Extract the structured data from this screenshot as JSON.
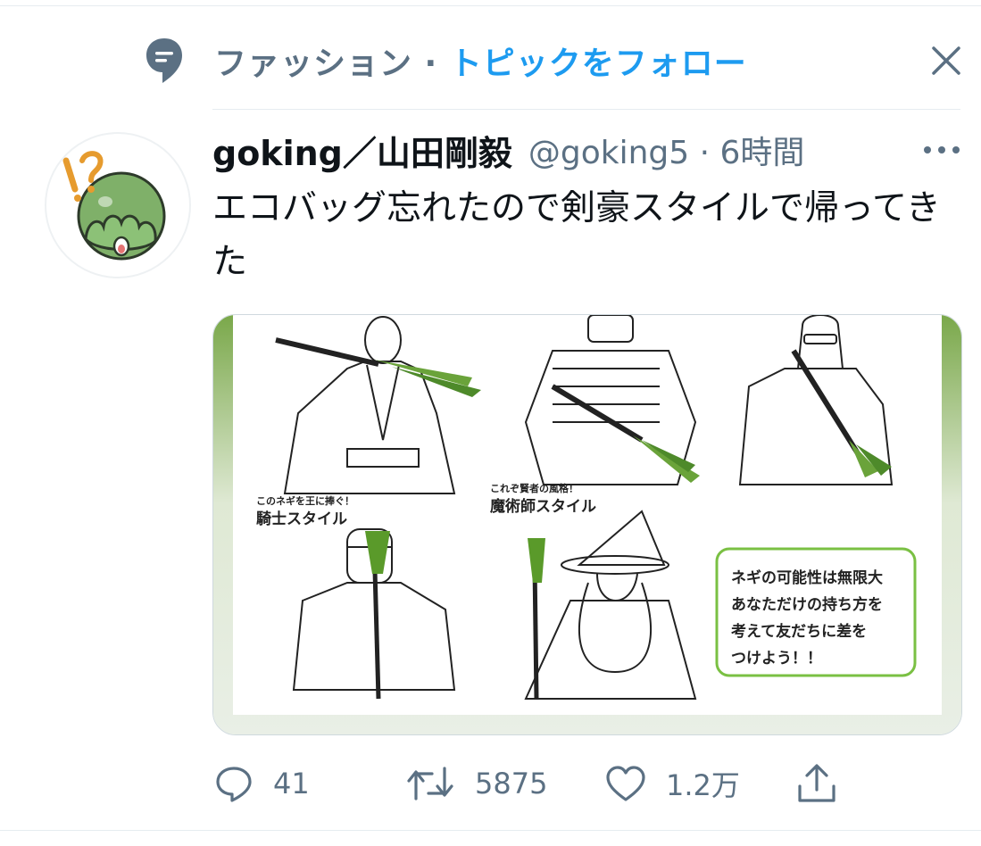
{
  "topic": {
    "category": "ファッション",
    "separator": " · ",
    "follow_link": "トピックをフォロー"
  },
  "tweet": {
    "display_name": "goking／山田剛毅",
    "handle": "@goking5",
    "time_separator": " · ",
    "time": "6時間",
    "text": "エコバッグ忘れたので剣豪スタイルで帰ってきた",
    "media": {
      "knight_caption": "このネギを王に捧ぐ！",
      "knight_title": "騎士スタイル",
      "wizard_caption": "これぞ賢者の風格！",
      "wizard_title": "魔術師スタイル",
      "note_lines": [
        "ネギの可能性は無限大",
        "あなただけの持ち方を",
        "考えて友だちに差を",
        "つけよう！！"
      ]
    }
  },
  "actions": {
    "reply_count": "41",
    "retweet_count": "5875",
    "like_count": "1.2万"
  },
  "colors": {
    "accent": "#1d9bf0",
    "secondary_text": "#5b7083",
    "leek_green": "#6aa33a",
    "avatar_green": "#7fb069"
  }
}
